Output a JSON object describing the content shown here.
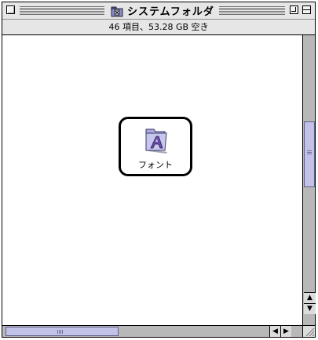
{
  "window": {
    "title": "システムフォルダ",
    "title_icon": "system-folder-icon"
  },
  "info": {
    "summary": "46 項目、53.28 GB 空き"
  },
  "items": [
    {
      "label": "フォント",
      "icon": "fonts-folder-icon",
      "selected": true
    }
  ],
  "scrollbars": {
    "vertical_arrow_up": "▲",
    "vertical_arrow_down": "▼",
    "horizontal_arrow_left": "◀",
    "horizontal_arrow_right": "▶"
  },
  "colors": {
    "scroll_thumb": "#c2c2e8",
    "scroll_track": "#b8b8b8",
    "window_chrome": "#e6e6e6"
  }
}
